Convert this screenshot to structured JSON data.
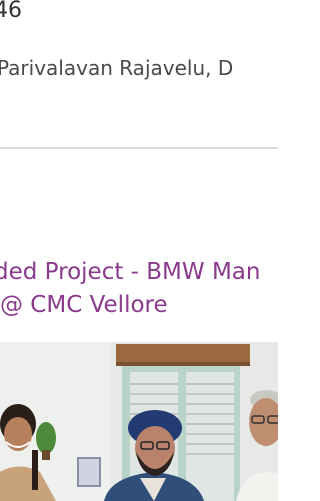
{
  "header": {
    "top_text": "46",
    "authors_text": "Parivalavan Rajavelu, D"
  },
  "article": {
    "title_line1": "ded Project - BMW Man",
    "title_line2": "@ CMC Vellore"
  },
  "photo": {
    "description_icon": "photo-image"
  }
}
